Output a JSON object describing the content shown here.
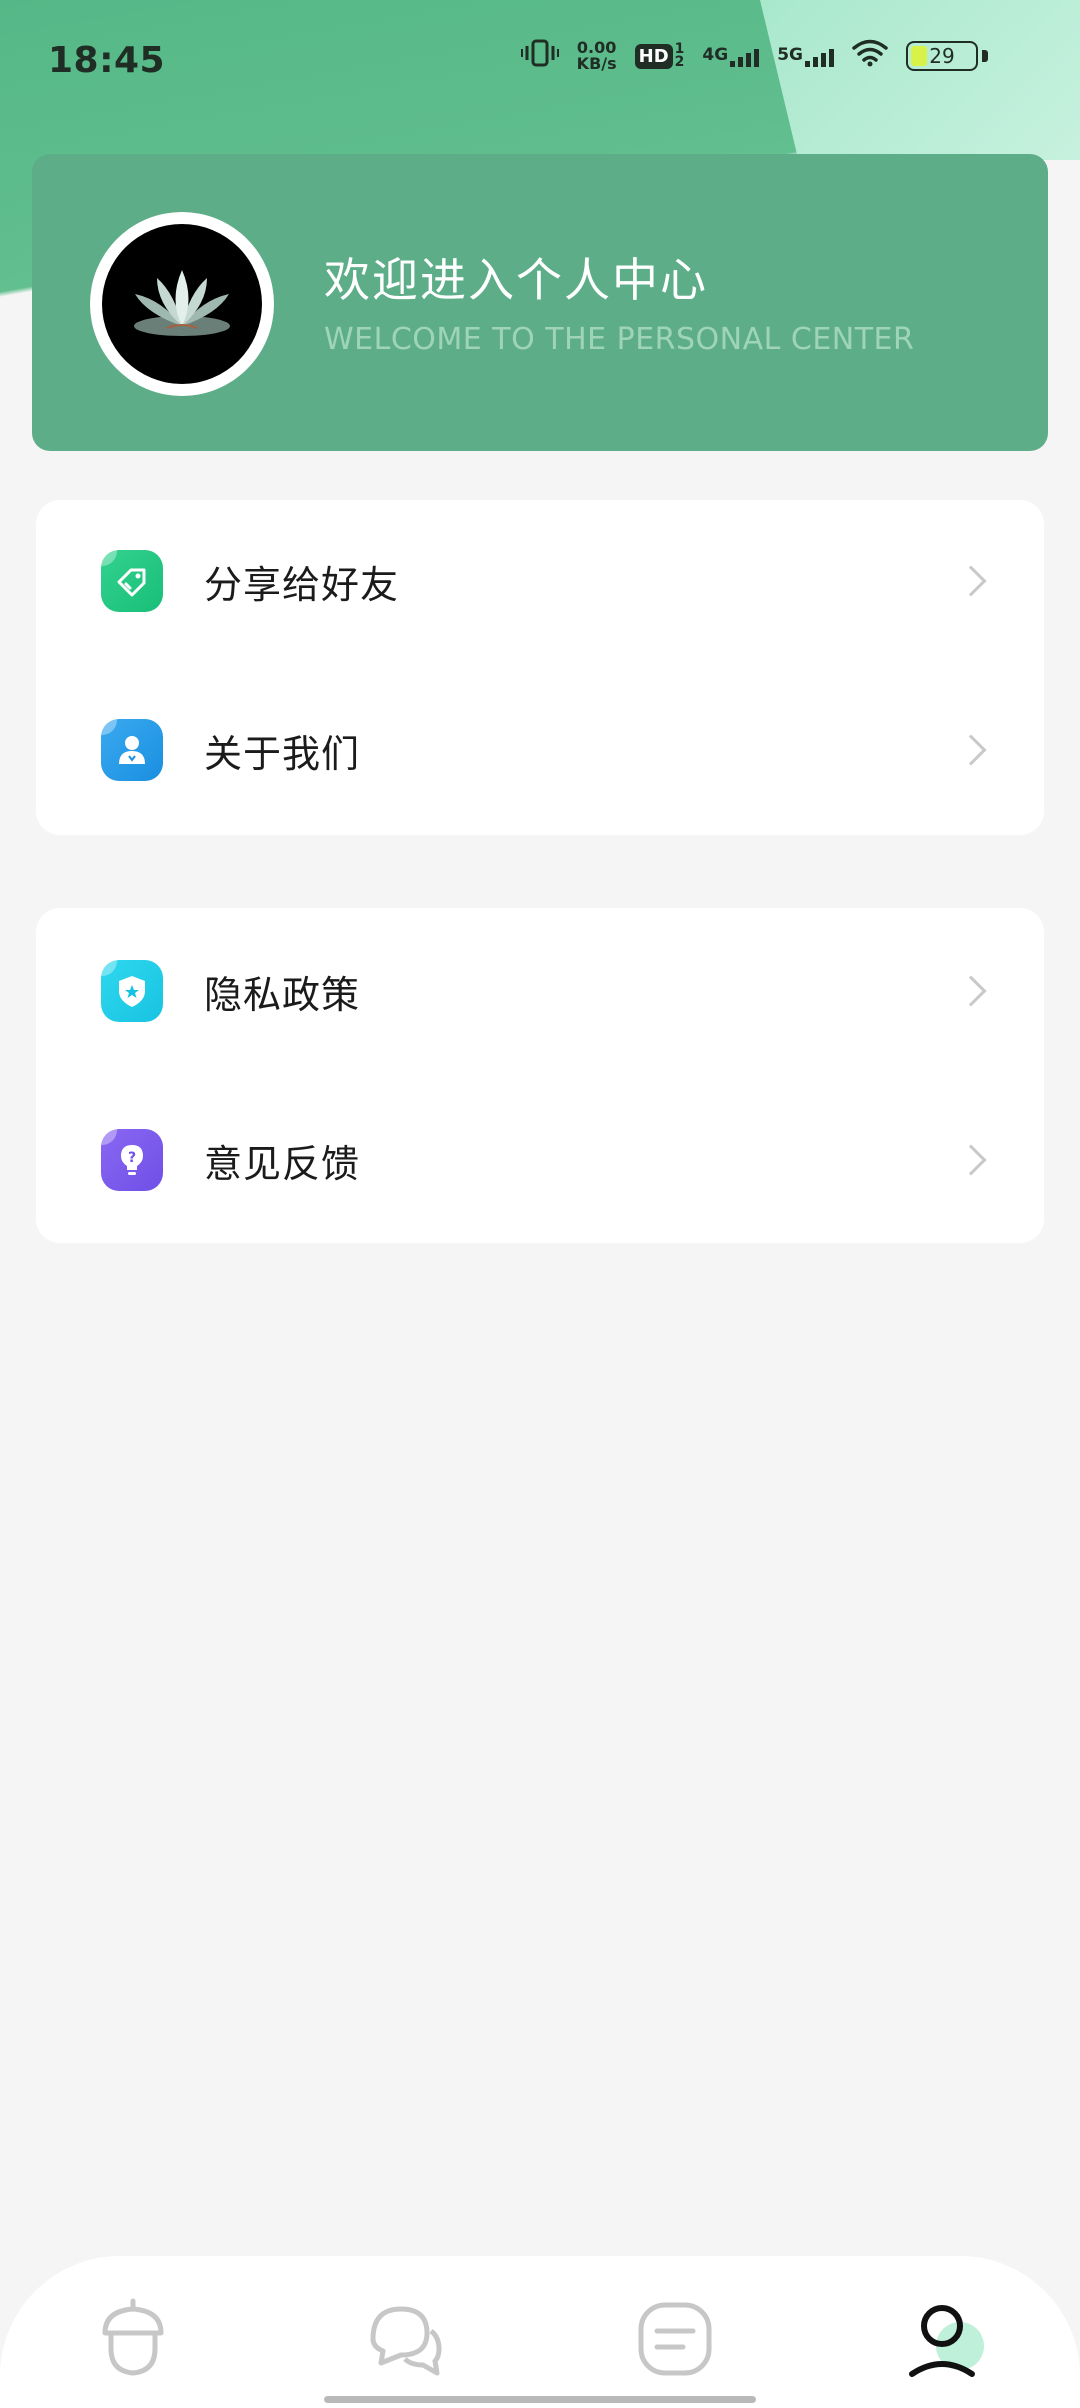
{
  "status_bar": {
    "time": "18:45",
    "net_speed_value": "0.00",
    "net_speed_unit": "KB/s",
    "hd_label": "HD",
    "hd_sup": "1",
    "hd_sub": "2",
    "net_4g": "4G",
    "net_5g": "5G",
    "battery": "29",
    "icons": [
      "vibrate-icon",
      "wifi-icon",
      "signal-icon",
      "battery-icon"
    ]
  },
  "profile": {
    "title": "欢迎进入个人中心",
    "subtitle": "WELCOME TO THE PERSONAL CENTER",
    "avatar_icon": "lotus-avatar-icon"
  },
  "menu": {
    "group1": [
      {
        "label": "分享给好友",
        "icon": "share-tag-icon",
        "color": "#1fc47e"
      },
      {
        "label": "关于我们",
        "icon": "about-user-icon",
        "color": "#1f93e3"
      }
    ],
    "group2": [
      {
        "label": "隐私政策",
        "icon": "shield-icon",
        "color": "#1dc8e5"
      },
      {
        "label": "意见反馈",
        "icon": "lightbulb-icon",
        "color": "#7555ea"
      }
    ]
  },
  "tabbar": {
    "active": "profile",
    "tabs": [
      {
        "id": "home",
        "icon": "acorn-home-icon"
      },
      {
        "id": "chat",
        "icon": "chat-bubbles-icon"
      },
      {
        "id": "notes",
        "icon": "notes-icon"
      },
      {
        "id": "profile",
        "icon": "profile-icon"
      }
    ]
  },
  "colors": {
    "accent_green": "#5dae88",
    "header_green": "#55b787",
    "mint": "#bff0d9"
  }
}
